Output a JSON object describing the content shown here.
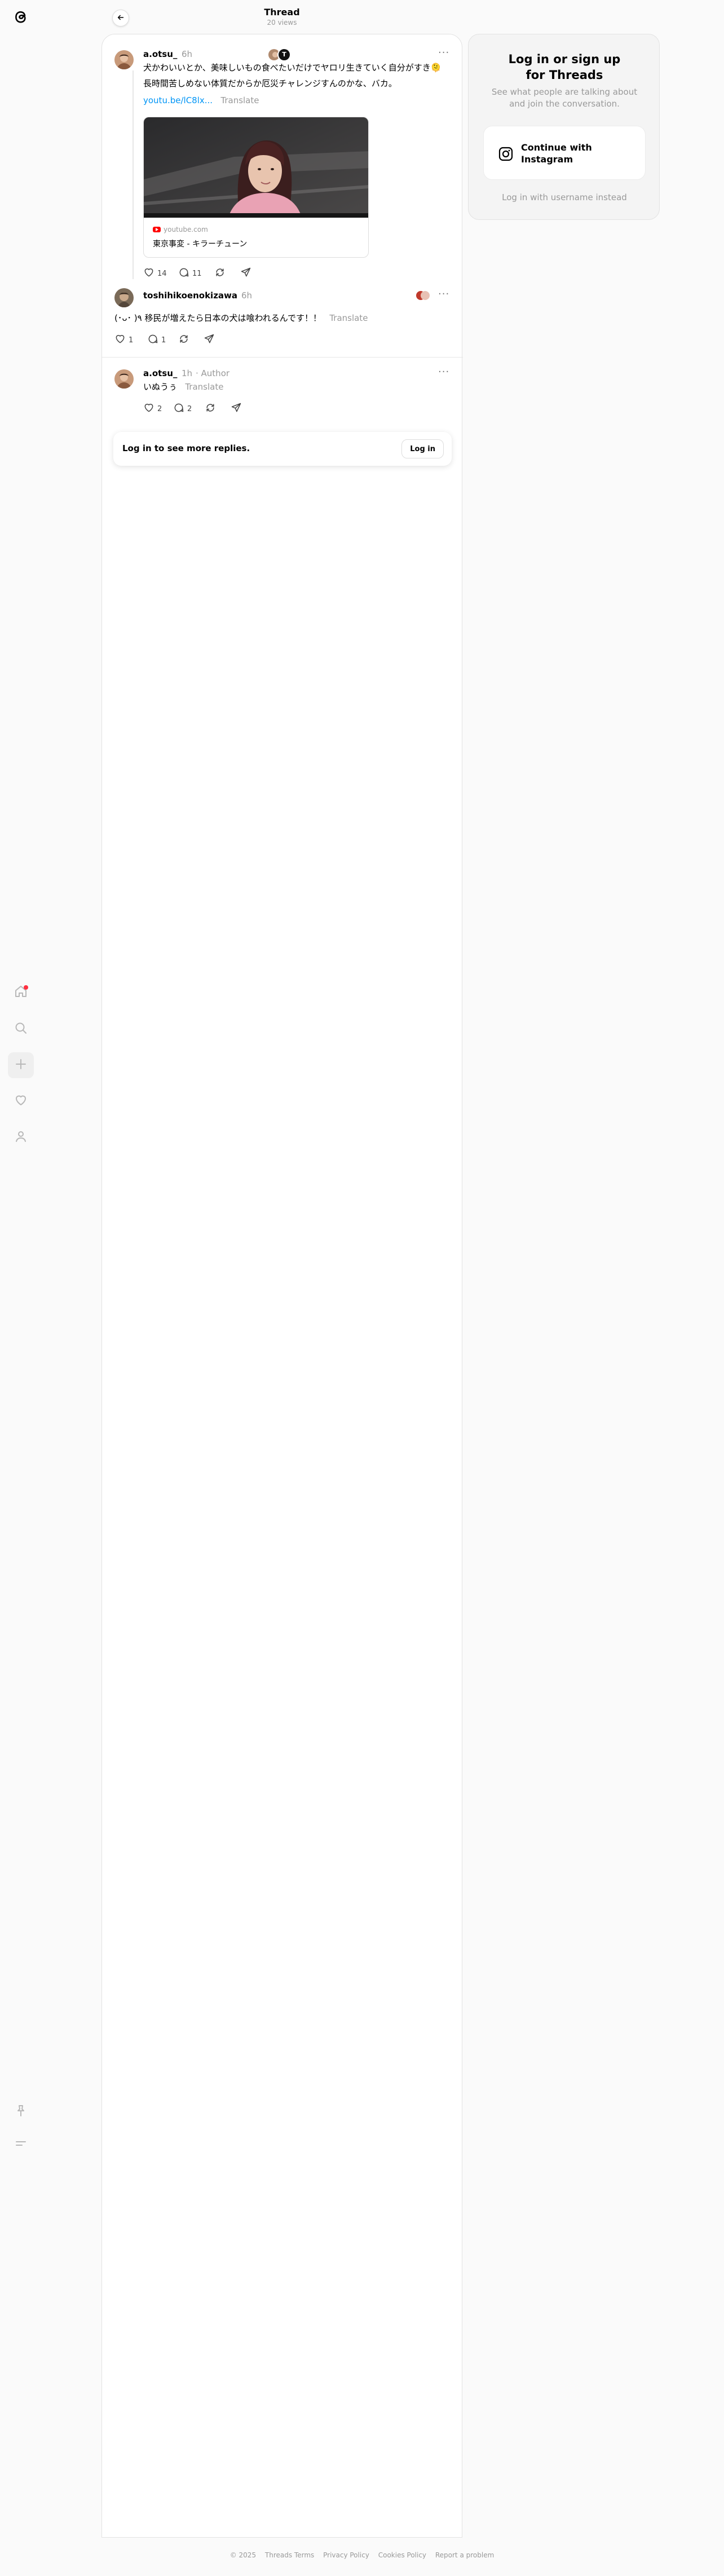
{
  "header": {
    "title": "Thread",
    "views": "20 views"
  },
  "nav": [
    {
      "name": "home-icon"
    },
    {
      "name": "search-icon"
    },
    {
      "name": "create-icon"
    },
    {
      "name": "activity-icon"
    },
    {
      "name": "profile-icon"
    },
    {
      "name": "pin-icon"
    },
    {
      "name": "menu-icon"
    }
  ],
  "posts": [
    {
      "username": "a.otsu_",
      "time": "6h",
      "text_line1": "犬かわいいとか、美味しいもの食べたいだけでヤロリ生きていく自分がすき🫠",
      "text_line2": "長時間苦しめない体質だからか厄災チャレンジすんのかな、バカ。",
      "link": "youtu.be/lC8lx...",
      "translate": "Translate",
      "card": {
        "domain": "youtube.com",
        "title": "東京事変 - キラーチューン"
      },
      "likes": "14",
      "replies": "11"
    },
    {
      "username": "toshihikoenokizawa",
      "time": "6h",
      "text": "(･ᴗ･ )٩ 移民が増えたら日本の犬は喰われるんです！！",
      "translate": "Translate",
      "likes": "1",
      "replies": "1"
    },
    {
      "username": "a.otsu_",
      "time": "1h",
      "author": "· Author",
      "text": "いぬうぅ",
      "translate": "Translate",
      "likes": "2",
      "replies": "2"
    }
  ],
  "login_bar": {
    "text": "Log in to see more replies.",
    "button": "Log in"
  },
  "side": {
    "title_line1": "Log in or sign up",
    "title_line2": "for Threads",
    "subtitle": "See what people are talking about and join the conversation.",
    "instagram_line1": "Continue with",
    "instagram_line2": "Instagram",
    "alt_login": "Log in with username instead"
  },
  "footer": [
    "© 2025",
    "Threads Terms",
    "Privacy Policy",
    "Cookies Policy",
    "Report a problem"
  ],
  "colors": {
    "link": "#0095f6",
    "notification": "#ff3040"
  }
}
